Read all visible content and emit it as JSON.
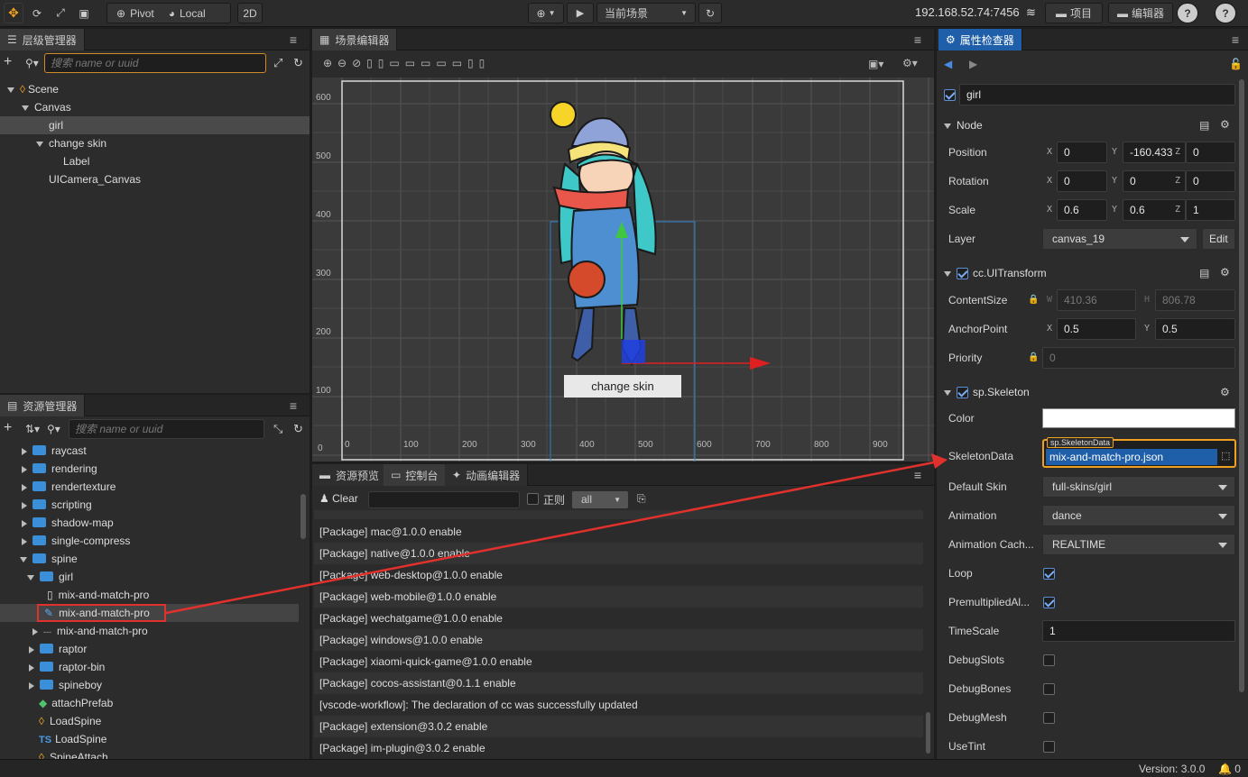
{
  "toolbar": {
    "pivot": "Pivot",
    "local": "Local",
    "mode2d": "2D",
    "scene_select": "当前场景",
    "ip": "192.168.52.74:7456",
    "project_btn": "项目",
    "editor_btn": "编辑器"
  },
  "hierarchy": {
    "title": "层级管理器",
    "search_placeholder": "搜索 name or uuid",
    "nodes": [
      "Scene",
      "Canvas",
      "girl",
      "change skin",
      "Label",
      "UICamera_Canvas"
    ]
  },
  "assets": {
    "title": "资源管理器",
    "search_placeholder": "搜索 name or uuid",
    "items": [
      "raycast",
      "rendering",
      "rendertexture",
      "scripting",
      "shadow-map",
      "single-compress",
      "spine",
      "girl",
      "mix-and-match-pro",
      "mix-and-match-pro",
      "mix-and-match-pro",
      "raptor",
      "raptor-bin",
      "spineboy",
      "attachPrefab",
      "LoadSpine",
      "LoadSpine",
      "SpineAttach"
    ]
  },
  "scene": {
    "title": "场景编辑器",
    "y_ticks": [
      "600",
      "500",
      "400",
      "300",
      "200",
      "100",
      "0"
    ],
    "x_ticks": [
      "0",
      "100",
      "200",
      "300",
      "400",
      "500",
      "600",
      "700",
      "800",
      "900"
    ],
    "button_label": "change skin"
  },
  "console": {
    "tabs": [
      "资源预览",
      "控制台",
      "动画编辑器"
    ],
    "clear": "Clear",
    "regex": "正则",
    "level": "all",
    "lines": [
      "[Package] mac@1.0.0 enable",
      "[Package] native@1.0.0 enable",
      "[Package] web-desktop@1.0.0 enable",
      "[Package] web-mobile@1.0.0 enable",
      "[Package] wechatgame@1.0.0 enable",
      "[Package] windows@1.0.0 enable",
      "[Package] xiaomi-quick-game@1.0.0 enable",
      "[Package] cocos-assistant@0.1.1 enable",
      "[vscode-workflow]: The declaration of cc was successfully updated",
      "[Package] extension@3.0.2 enable",
      "[Package] im-plugin@3.0.2 enable"
    ]
  },
  "inspector": {
    "title": "属性检查器",
    "node_name": "girl",
    "node_section": "Node",
    "position_label": "Position",
    "position": [
      "0",
      "-160.433",
      "0"
    ],
    "rotation_label": "Rotation",
    "rotation": [
      "0",
      "0",
      "0"
    ],
    "scale_label": "Scale",
    "scale": [
      "0.6",
      "0.6",
      "1"
    ],
    "layer_label": "Layer",
    "layer": "canvas_19",
    "edit": "Edit",
    "uitransform": "cc.UITransform",
    "contentsize_label": "ContentSize",
    "contentsize": [
      "410.36",
      "806.78"
    ],
    "anchor_label": "AnchorPoint",
    "anchor": [
      "0.5",
      "0.5"
    ],
    "priority_label": "Priority",
    "priority": "0",
    "skeleton": "sp.Skeleton",
    "color_label": "Color",
    "skeletondata_label": "SkeletonData",
    "skeletondata_type": "sp.SkeletonData",
    "skeletondata": "mix-and-match-pro.json",
    "defaultskin_label": "Default Skin",
    "defaultskin": "full-skins/girl",
    "animation_label": "Animation",
    "animation": "dance",
    "animcache_label": "Animation Cach...",
    "animcache": "REALTIME",
    "loop_label": "Loop",
    "premul_label": "PremultipliedAl...",
    "timescale_label": "TimeScale",
    "timescale": "1",
    "debugslots_label": "DebugSlots",
    "debugbones_label": "DebugBones",
    "debugmesh_label": "DebugMesh",
    "usetint_label": "UseTint"
  },
  "status": {
    "version": "Version: 3.0.0",
    "notif": "0"
  },
  "colors": {
    "accent": "#3a8fd8",
    "highlight": "#e0312c"
  }
}
